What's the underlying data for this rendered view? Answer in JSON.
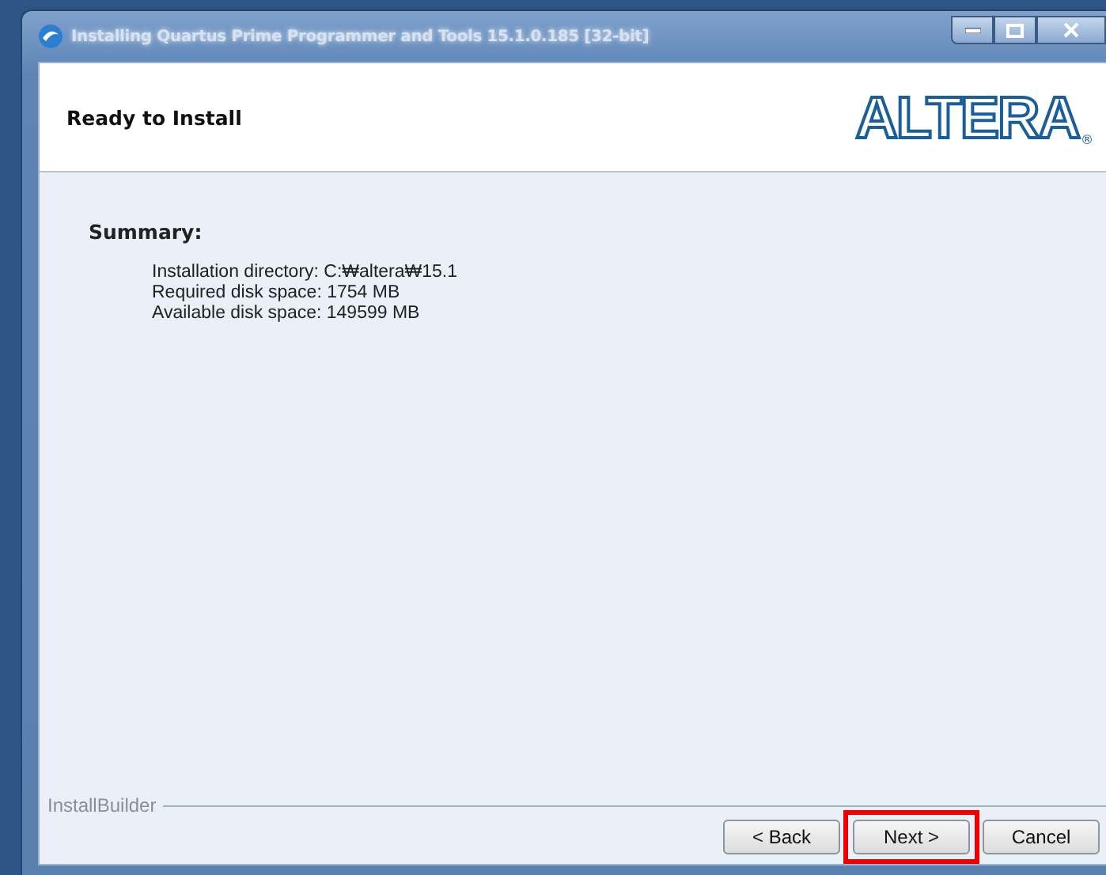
{
  "window": {
    "title": "Installing Quartus Prime Programmer and Tools 15.1.0.185 [32-bit]"
  },
  "header": {
    "title": "Ready to Install",
    "logo": "ALTERA",
    "logo_mark": "®"
  },
  "summary": {
    "heading": "Summary:",
    "lines": [
      "Installation directory: C:₩altera₩15.1",
      "Required disk space: 1754 MB",
      "Available disk space: 149599 MB"
    ]
  },
  "footer": {
    "brand": "InstallBuilder"
  },
  "buttons": [
    {
      "label": "< Back",
      "highlighted": false
    },
    {
      "label": "Next >",
      "highlighted": true
    },
    {
      "label": "Cancel",
      "highlighted": false
    }
  ]
}
